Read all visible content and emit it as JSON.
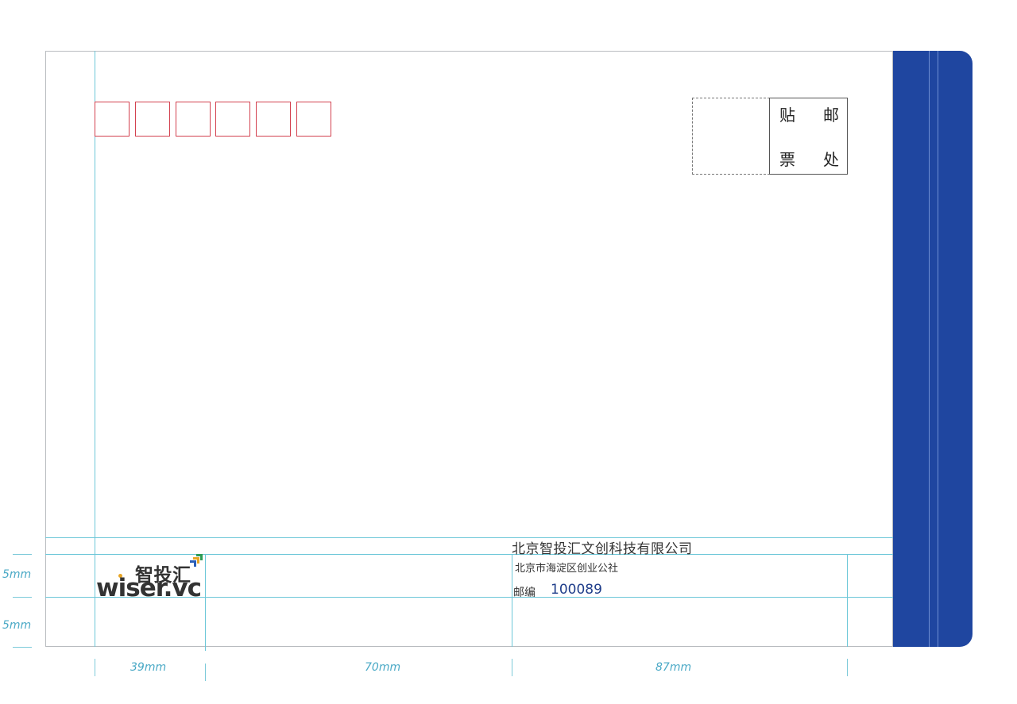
{
  "stamp_area": {
    "chars": [
      "贴",
      "邮",
      "票",
      "处"
    ]
  },
  "sender": {
    "company": "北京智投汇文创科技有限公司",
    "address": "北京市海淀区创业公社",
    "zip_label": "邮编",
    "zip_code": "100089"
  },
  "logo": {
    "name_cn": "智投汇",
    "name_en": "wiser.vc"
  },
  "dimensions": {
    "height_top": "5mm",
    "height_bottom": "5mm",
    "width_1": "39mm",
    "width_2": "70mm",
    "width_3": "87mm"
  },
  "colors": {
    "flap": "#1f46a0",
    "zip_box_border": "#d3414f",
    "guide_line": "#6cc7d8",
    "zip_code_text": "#1f3d8a"
  },
  "postal_code_boxes": 6
}
